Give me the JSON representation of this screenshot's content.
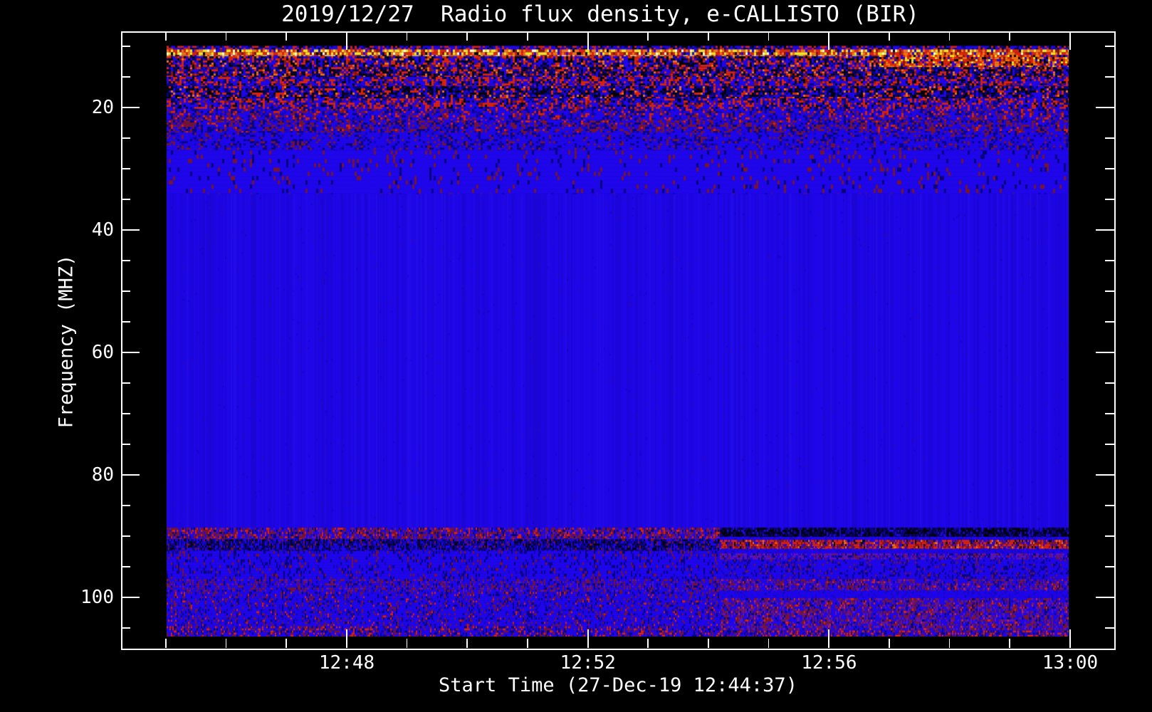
{
  "chart_data": {
    "type": "heatmap",
    "subtype": "radio-spectrogram",
    "title": "2019/12/27  Radio flux density, e-CALLISTO (BIR)",
    "xlabel": "Start Time (27-Dec-19 12:44:37)",
    "ylabel": "Frequency (MHZ)",
    "x_axis": {
      "start_time": "12:44:37",
      "major_tick_labels": [
        "12:48",
        "12:52",
        "12:56",
        "13:00"
      ],
      "major_tick_minutes": [
        3,
        7,
        11,
        15
      ],
      "minor_tick_minutes": [
        0,
        1,
        2,
        4,
        5,
        6,
        8,
        9,
        10,
        12,
        13,
        14
      ],
      "minor_interval": "1 min"
    },
    "y_axis": {
      "major_ticks": [
        20,
        40,
        60,
        80,
        100
      ],
      "minor_ticks": [
        10,
        15,
        25,
        30,
        35,
        45,
        50,
        55,
        65,
        70,
        75,
        85,
        90,
        95,
        105
      ],
      "unit": "MHz",
      "direction": "inverted (low frequency at top)",
      "data_range_mhz": [
        9.8,
        106.3
      ]
    },
    "legend": "none",
    "grid": "off",
    "palette": {
      "background": "#000000",
      "text": "#ffffff",
      "axis": "#ffffff",
      "blue": "#1E06E8",
      "midblue": "#1404B6",
      "navy": "#08027A",
      "black": "#02000C",
      "red": "#DC2404",
      "darkred": "#8C1404",
      "orange": "#F07410",
      "yellow": "#F2E51C",
      "paleyellow": "#FFFFC0",
      "maroon": "#77142E",
      "violet": "#5C14B4"
    },
    "fm_split_fraction": 0.613,
    "bands": [
      {
        "f": [
          7.6,
          9.8
        ],
        "pal": [
          [
            "black",
            100
          ]
        ],
        "cell": [
          8,
          8
        ],
        "note": "blank region above data"
      },
      {
        "f": [
          9.8,
          10.4
        ],
        "pal": [
          [
            "blue",
            50
          ],
          [
            "red",
            25
          ],
          [
            "black",
            15
          ],
          [
            "navy",
            10
          ]
        ],
        "cell": [
          3,
          3
        ]
      },
      {
        "f": [
          10.4,
          11.5
        ],
        "pal": [
          [
            "yellow",
            24
          ],
          [
            "paleyellow",
            8
          ],
          [
            "orange",
            26
          ],
          [
            "red",
            22
          ],
          [
            "darkred",
            8
          ],
          [
            "black",
            7
          ],
          [
            "blue",
            5
          ]
        ],
        "cell": [
          3,
          4
        ],
        "note": "intense RFI line"
      },
      {
        "f": [
          11.5,
          13.3
        ],
        "pal": [
          [
            "blue",
            30
          ],
          [
            "black",
            22
          ],
          [
            "red",
            22
          ],
          [
            "navy",
            16
          ],
          [
            "orange",
            6
          ],
          [
            "darkred",
            4
          ]
        ],
        "cell": [
          3,
          3
        ]
      },
      {
        "f": [
          11.3,
          13.3
        ],
        "t": [
          0.79,
          1
        ],
        "pal": [
          [
            "orange",
            26
          ],
          [
            "red",
            30
          ],
          [
            "yellow",
            12
          ],
          [
            "black",
            12
          ],
          [
            "blue",
            10
          ],
          [
            "darkred",
            10
          ]
        ],
        "cell": [
          3,
          3
        ],
        "note": "brighter RFI on right side"
      },
      {
        "f": [
          13.3,
          14.9
        ],
        "pal": [
          [
            "black",
            30
          ],
          [
            "navy",
            22
          ],
          [
            "blue",
            17
          ],
          [
            "red",
            18
          ],
          [
            "orange",
            7
          ],
          [
            "darkred",
            6
          ]
        ],
        "cell": [
          3,
          3
        ]
      },
      {
        "f": [
          14.9,
          16.4
        ],
        "pal": [
          [
            "blue",
            42
          ],
          [
            "red",
            26
          ],
          [
            "black",
            12
          ],
          [
            "navy",
            14
          ],
          [
            "darkred",
            6
          ]
        ],
        "cell": [
          3,
          3
        ]
      },
      {
        "f": [
          16.4,
          18.4
        ],
        "pal": [
          [
            "black",
            28
          ],
          [
            "navy",
            28
          ],
          [
            "blue",
            20
          ],
          [
            "red",
            16
          ],
          [
            "orange",
            4
          ],
          [
            "midblue",
            4
          ]
        ],
        "cell": [
          3,
          3
        ]
      },
      {
        "f": [
          18.4,
          20.1
        ],
        "pal": [
          [
            "blue",
            40
          ],
          [
            "red",
            26
          ],
          [
            "navy",
            16
          ],
          [
            "black",
            10
          ],
          [
            "darkred",
            8
          ]
        ],
        "cell": [
          3,
          3
        ]
      },
      {
        "f": [
          20.1,
          22.0
        ],
        "pal": [
          [
            "blue",
            50
          ],
          [
            "red",
            12
          ],
          [
            "maroon",
            14
          ],
          [
            "navy",
            16
          ],
          [
            "midblue",
            8
          ]
        ],
        "cell": [
          3,
          3
        ]
      },
      {
        "f": [
          22.0,
          24.0
        ],
        "pal": [
          [
            "blue",
            45
          ],
          [
            "maroon",
            28
          ],
          [
            "navy",
            17
          ],
          [
            "midblue",
            6
          ],
          [
            "red",
            4
          ]
        ],
        "cell": [
          3,
          3
        ]
      },
      {
        "f": [
          24.0,
          26.9
        ],
        "pal": [
          [
            "blue",
            72
          ],
          [
            "maroon",
            10
          ],
          [
            "navy",
            12
          ],
          [
            "midblue",
            6
          ]
        ],
        "cell": [
          3,
          3
        ]
      },
      {
        "f": [
          26.9,
          34.0
        ],
        "pal": [
          [
            "blue",
            92
          ],
          [
            "maroon",
            5
          ],
          [
            "navy",
            3
          ]
        ],
        "cell": [
          3,
          6
        ],
        "note": "fading wisps"
      },
      {
        "f": [
          88.5,
          90.4
        ],
        "t": [
          0,
          0.613
        ],
        "pal": [
          [
            "blue",
            34
          ],
          [
            "maroon",
            30
          ],
          [
            "red",
            12
          ],
          [
            "violet",
            12
          ],
          [
            "navy",
            12
          ]
        ],
        "cell": [
          2,
          3
        ]
      },
      {
        "f": [
          90.4,
          92.3
        ],
        "t": [
          0,
          0.613
        ],
        "pal": [
          [
            "navy",
            34
          ],
          [
            "black",
            22
          ],
          [
            "blue",
            28
          ],
          [
            "midblue",
            8
          ],
          [
            "maroon",
            8
          ]
        ],
        "cell": [
          2,
          3
        ]
      },
      {
        "f": [
          92.3,
          96.9
        ],
        "t": [
          0,
          0.613
        ],
        "pal": [
          [
            "blue",
            80
          ],
          [
            "navy",
            10
          ],
          [
            "maroon",
            6
          ],
          [
            "midblue",
            4
          ]
        ],
        "cell": [
          2,
          4
        ]
      },
      {
        "f": [
          96.9,
          99.0
        ],
        "t": [
          0,
          0.613
        ],
        "pal": [
          [
            "blue",
            60
          ],
          [
            "maroon",
            20
          ],
          [
            "navy",
            12
          ],
          [
            "violet",
            8
          ]
        ],
        "cell": [
          2,
          3
        ]
      },
      {
        "f": [
          99.0,
          104.6
        ],
        "t": [
          0,
          0.613
        ],
        "pal": [
          [
            "blue",
            72
          ],
          [
            "maroon",
            10
          ],
          [
            "navy",
            10
          ],
          [
            "midblue",
            5
          ],
          [
            "red",
            3
          ]
        ],
        "cell": [
          2,
          3
        ]
      },
      {
        "f": [
          104.6,
          106.3
        ],
        "t": [
          0,
          0.613
        ],
        "pal": [
          [
            "blue",
            50
          ],
          [
            "red",
            14
          ],
          [
            "maroon",
            18
          ],
          [
            "navy",
            18
          ]
        ],
        "cell": [
          2,
          3
        ]
      },
      {
        "f": [
          88.5,
          90.0
        ],
        "t": [
          0.613,
          1
        ],
        "pal": [
          [
            "black",
            55
          ],
          [
            "navy",
            30
          ],
          [
            "blue",
            10
          ],
          [
            "midblue",
            5
          ]
        ],
        "cell": [
          2,
          3
        ],
        "note": "dark absorption band after 12:55"
      },
      {
        "f": [
          90.0,
          90.5
        ],
        "t": [
          0.613,
          1
        ],
        "pal": [
          [
            "blue",
            80
          ],
          [
            "midblue",
            20
          ]
        ],
        "cell": [
          2,
          2
        ]
      },
      {
        "f": [
          90.5,
          92.0
        ],
        "t": [
          0.613,
          1
        ],
        "pal": [
          [
            "red",
            40
          ],
          [
            "darkred",
            12
          ],
          [
            "blue",
            18
          ],
          [
            "orange",
            6
          ],
          [
            "maroon",
            16
          ],
          [
            "black",
            8
          ]
        ],
        "cell": [
          2,
          3
        ],
        "note": "FM interference band"
      },
      {
        "f": [
          92.0,
          92.7
        ],
        "t": [
          0.613,
          1
        ],
        "pal": [
          [
            "blue",
            85
          ],
          [
            "midblue",
            15
          ]
        ],
        "cell": [
          2,
          2
        ]
      },
      {
        "f": [
          92.7,
          93.7
        ],
        "t": [
          0.613,
          1
        ],
        "pal": [
          [
            "violet",
            40
          ],
          [
            "blue",
            30
          ],
          [
            "navy",
            15
          ],
          [
            "maroon",
            15
          ]
        ],
        "cell": [
          2,
          3
        ]
      },
      {
        "f": [
          93.7,
          96.9
        ],
        "t": [
          0.613,
          1
        ],
        "pal": [
          [
            "blue",
            78
          ],
          [
            "navy",
            12
          ],
          [
            "maroon",
            6
          ],
          [
            "midblue",
            4
          ]
        ],
        "cell": [
          2,
          3
        ]
      },
      {
        "f": [
          96.9,
          98.8
        ],
        "t": [
          0.613,
          1
        ],
        "pal": [
          [
            "blue",
            50
          ],
          [
            "maroon",
            22
          ],
          [
            "violet",
            14
          ],
          [
            "navy",
            8
          ],
          [
            "red",
            6
          ]
        ],
        "cell": [
          2,
          3
        ]
      },
      {
        "f": [
          98.8,
          100.0
        ],
        "t": [
          0.613,
          1
        ],
        "pal": [
          [
            "blue",
            85
          ],
          [
            "midblue",
            15
          ]
        ],
        "cell": [
          2,
          2
        ]
      },
      {
        "f": [
          100.0,
          105.3
        ],
        "t": [
          0.613,
          1
        ],
        "pal": [
          [
            "blue",
            48
          ],
          [
            "maroon",
            24
          ],
          [
            "violet",
            14
          ],
          [
            "navy",
            8
          ],
          [
            "red",
            6
          ]
        ],
        "cell": [
          2,
          3
        ]
      },
      {
        "f": [
          105.3,
          106.3
        ],
        "t": [
          0.613,
          1
        ],
        "pal": [
          [
            "blue",
            45
          ],
          [
            "red",
            18
          ],
          [
            "maroon",
            20
          ],
          [
            "navy",
            17
          ]
        ],
        "cell": [
          2,
          3
        ]
      }
    ]
  }
}
